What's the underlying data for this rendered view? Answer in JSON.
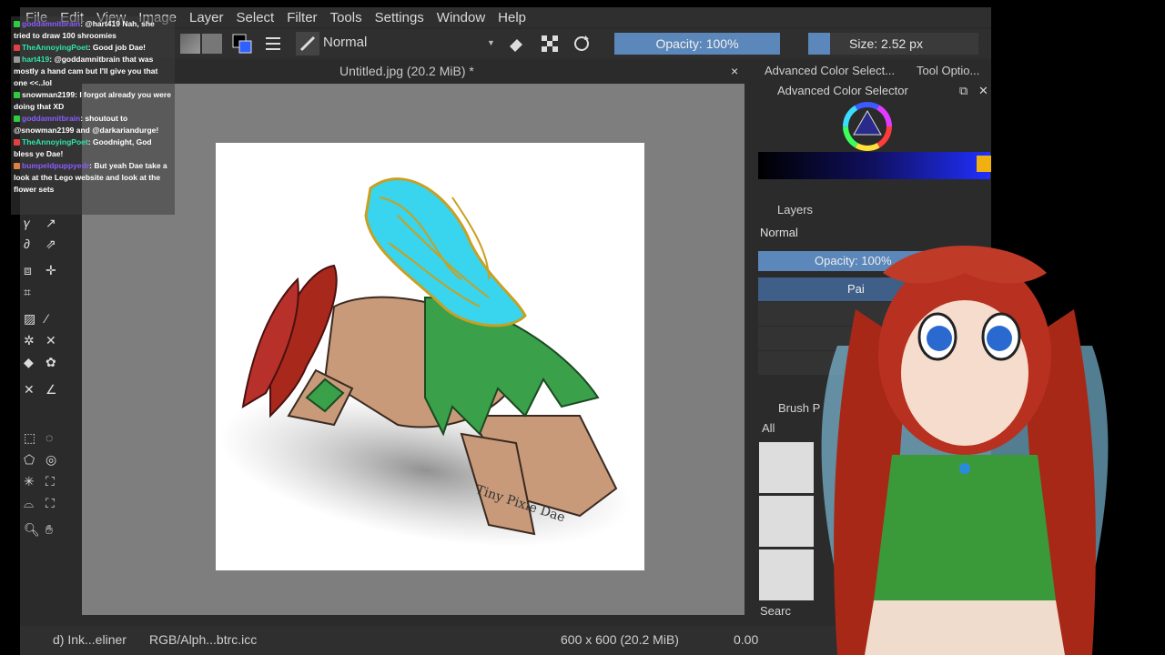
{
  "menubar": {
    "items": [
      "File",
      "Edit",
      "View",
      "Image",
      "Layer",
      "Select",
      "Filter",
      "Tools",
      "Settings",
      "Window",
      "Help"
    ]
  },
  "toolbar": {
    "blend_mode": "Normal",
    "opacity": "Opacity: 100%",
    "size": "Size: 2.52 px"
  },
  "document": {
    "title": "Untitled.jpg (20.2 MiB) *",
    "close": "×"
  },
  "dock": {
    "tab1": "Advanced Color Select...",
    "tab2": "Tool Optio...",
    "color_panel_title": "Advanced Color Selector",
    "layers_title": "Layers",
    "layers_blend": "Normal",
    "layers_opacity": "Opacity: 100%",
    "layer_name": "Pai",
    "brush_title": "Brush P",
    "brush_filter": "All",
    "search": "Searc"
  },
  "statusbar": {
    "brush_name": "d) Ink...eliner",
    "color_profile": "RGB/Alph...btrc.icc",
    "dimensions": "600 x 600 (20.2 MiB)",
    "rotation": "0.00"
  },
  "artwork": {
    "signature": "Tiny Pixie Dae"
  },
  "chat": [
    {
      "user": "goddamnitbrain",
      "user_color": "#8a5cff",
      "text": ": @hart419 Nah, she tried to draw 100 shroomies"
    },
    {
      "user": "TheAnnoyingPoet",
      "user_color": "#2ee6a8",
      "text": ": Good job Dae!"
    },
    {
      "user": "hart419",
      "user_color": "#2ee6a8",
      "text": ": @goddamnitbrain that was mostly a hand cam but I'll give you that one <<..lol"
    },
    {
      "user": "snowman2199",
      "user_color": "#ffffff",
      "text": ": I forgot already you were doing that XD"
    },
    {
      "user": "goddamnitbrain",
      "user_color": "#8a5cff",
      "text": ": shoutout to @snowman2199 and @darkariandurge!"
    },
    {
      "user": "TheAnnoyingPoet",
      "user_color": "#2ee6a8",
      "text": ": Goodnight, God bless ye Dae!"
    },
    {
      "user": "bumpeldpuppyedr",
      "user_color": "#8a5cff",
      "text": ": But yeah Dae take a look at the Lego website and look at the flower sets"
    }
  ],
  "colors": {
    "accent": "#5b87ba",
    "panel_bg": "#2b2b2b",
    "canvas_bg": "#7e7e7e"
  }
}
